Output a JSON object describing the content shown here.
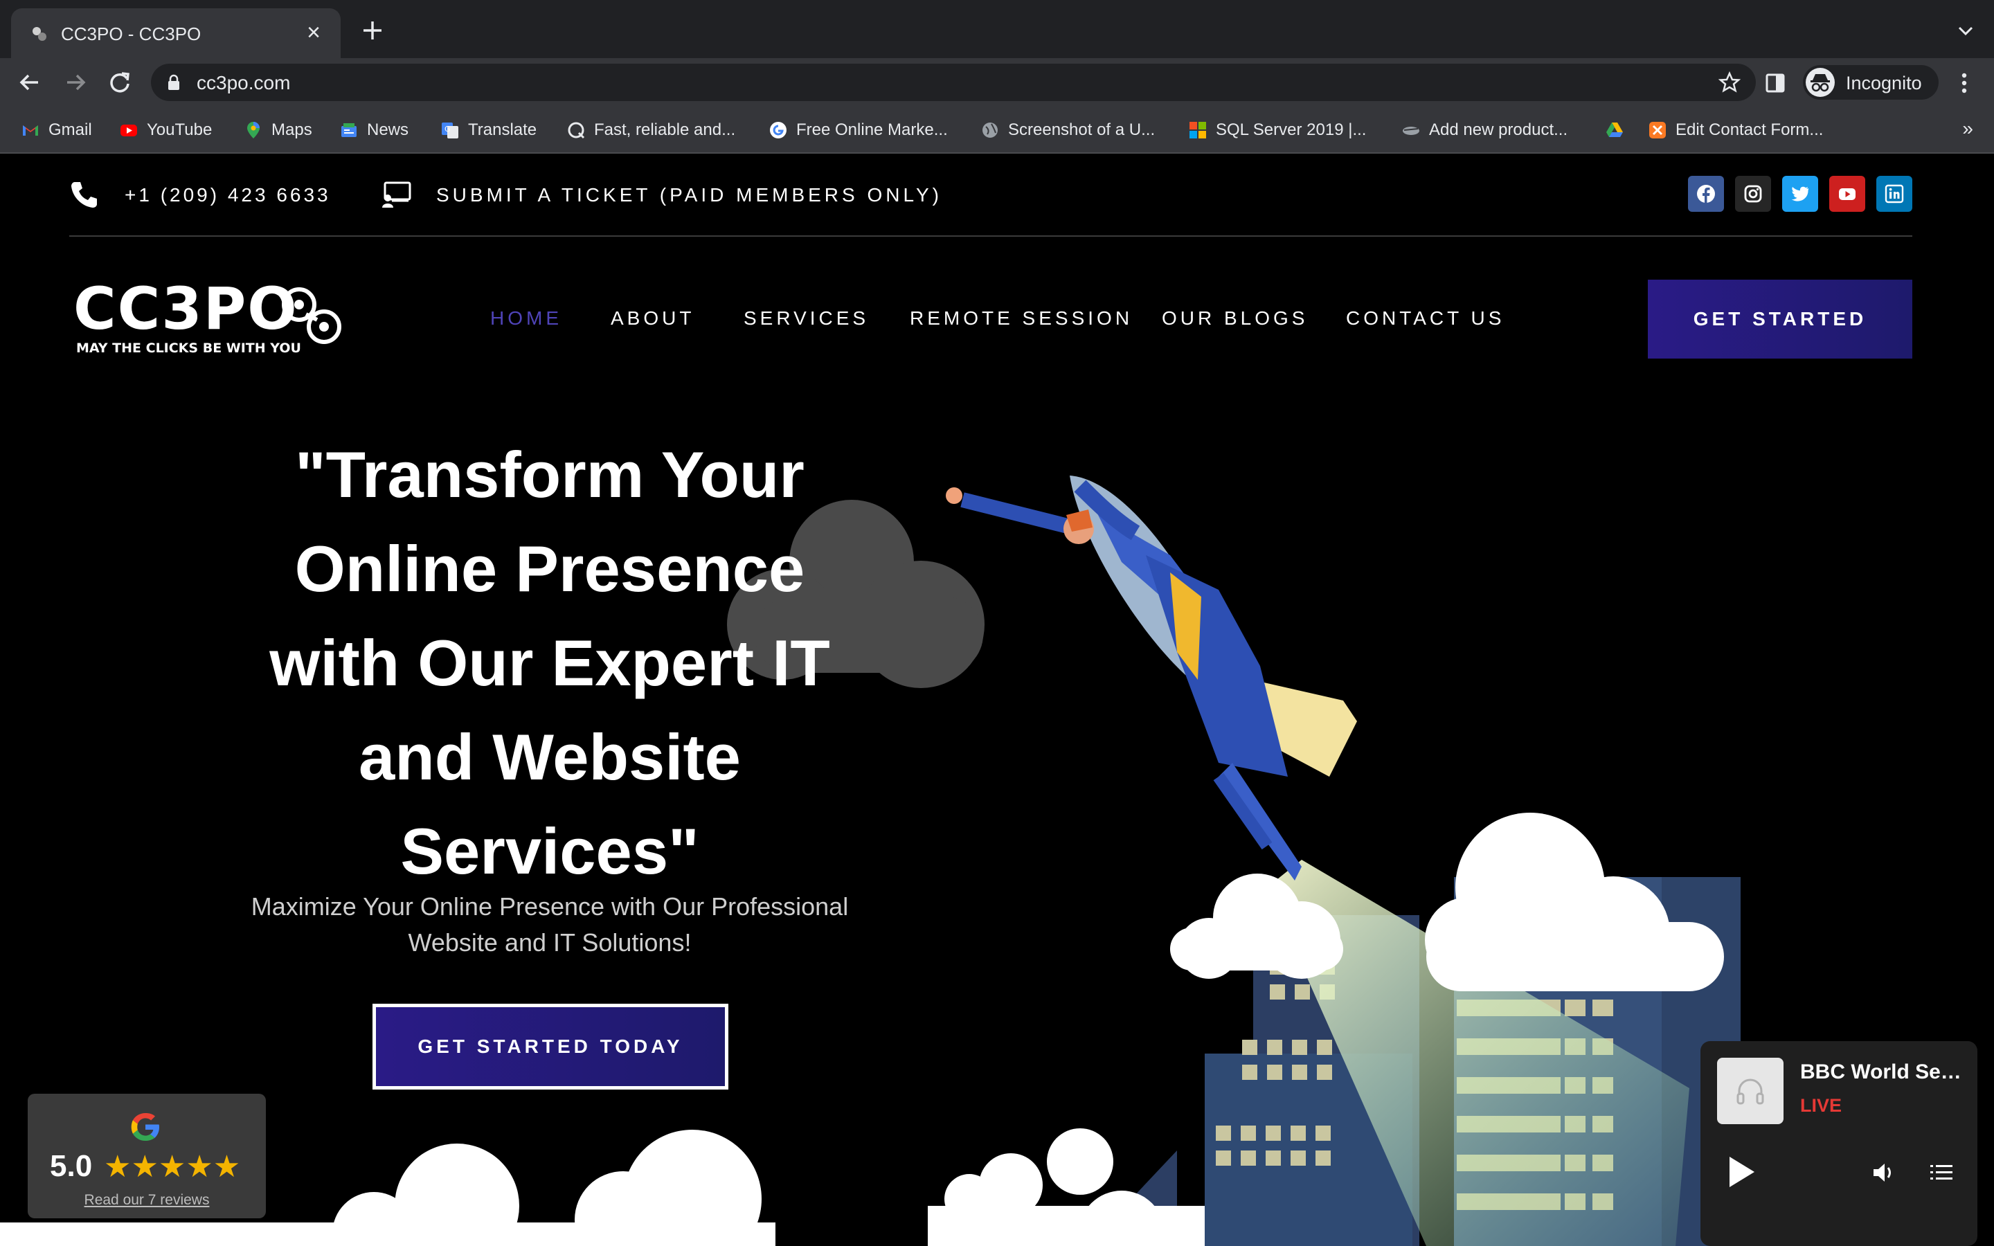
{
  "browser": {
    "tab_title": "CC3PO - CC3PO",
    "url": "cc3po.com",
    "profile_label": "Incognito",
    "bookmarks": [
      {
        "label": "Gmail",
        "icon": "gmail-icon"
      },
      {
        "label": "YouTube",
        "icon": "youtube-icon"
      },
      {
        "label": "Maps",
        "icon": "maps-icon"
      },
      {
        "label": "News",
        "icon": "news-icon"
      },
      {
        "label": "Translate",
        "icon": "translate-icon"
      },
      {
        "label": "Fast, reliable and...",
        "icon": "site-icon"
      },
      {
        "label": "Free Online Marke...",
        "icon": "google-icon"
      },
      {
        "label": "Screenshot of a U...",
        "icon": "globe-icon"
      },
      {
        "label": "SQL Server 2019 |...",
        "icon": "microsoft-icon"
      },
      {
        "label": "Add new product...",
        "icon": "site-icon"
      },
      {
        "label": "",
        "icon": "drive-icon"
      },
      {
        "label": "Edit Contact Form...",
        "icon": "xampp-icon"
      }
    ],
    "bookmarks_overflow": "»"
  },
  "topbar": {
    "phone": "+1 (209) 423 6633",
    "ticket": "SUBMIT A TICKET (PAID MEMBERS ONLY)",
    "social": [
      {
        "name": "facebook-icon",
        "color": "#3b5998"
      },
      {
        "name": "instagram-icon",
        "color": "#262626"
      },
      {
        "name": "twitter-icon",
        "color": "#1da1f2"
      },
      {
        "name": "youtube-icon",
        "color": "#cd201f"
      },
      {
        "name": "linkedin-icon",
        "color": "#0077b5"
      }
    ]
  },
  "logo": {
    "wordmark": "CC3PO",
    "tagline": "MAY THE CLICKS BE WITH YOU"
  },
  "nav": {
    "items": [
      "HOME",
      "ABOUT",
      "SERVICES",
      "REMOTE SESSION",
      "OUR BLOGS",
      "CONTACT US"
    ],
    "active": "HOME",
    "cta": "GET STARTED"
  },
  "hero": {
    "title_lines": [
      "\"Transform Your",
      "Online Presence",
      "with Our Expert IT",
      "and Website",
      "Services\""
    ],
    "subtitle_lines": [
      "Maximize Your Online Presence with Our Professional",
      "Website and IT Solutions!"
    ],
    "cta": "GET STARTED TODAY"
  },
  "review": {
    "rating": "5.0",
    "stars": "★★★★★",
    "link": "Read our 7 reviews"
  },
  "player": {
    "title": "BBC World Service",
    "status": "LIVE"
  },
  "colors": {
    "accent": "#2a1b86",
    "nav_active": "#4f44b8",
    "live": "#e53935",
    "star": "#f4b400"
  }
}
